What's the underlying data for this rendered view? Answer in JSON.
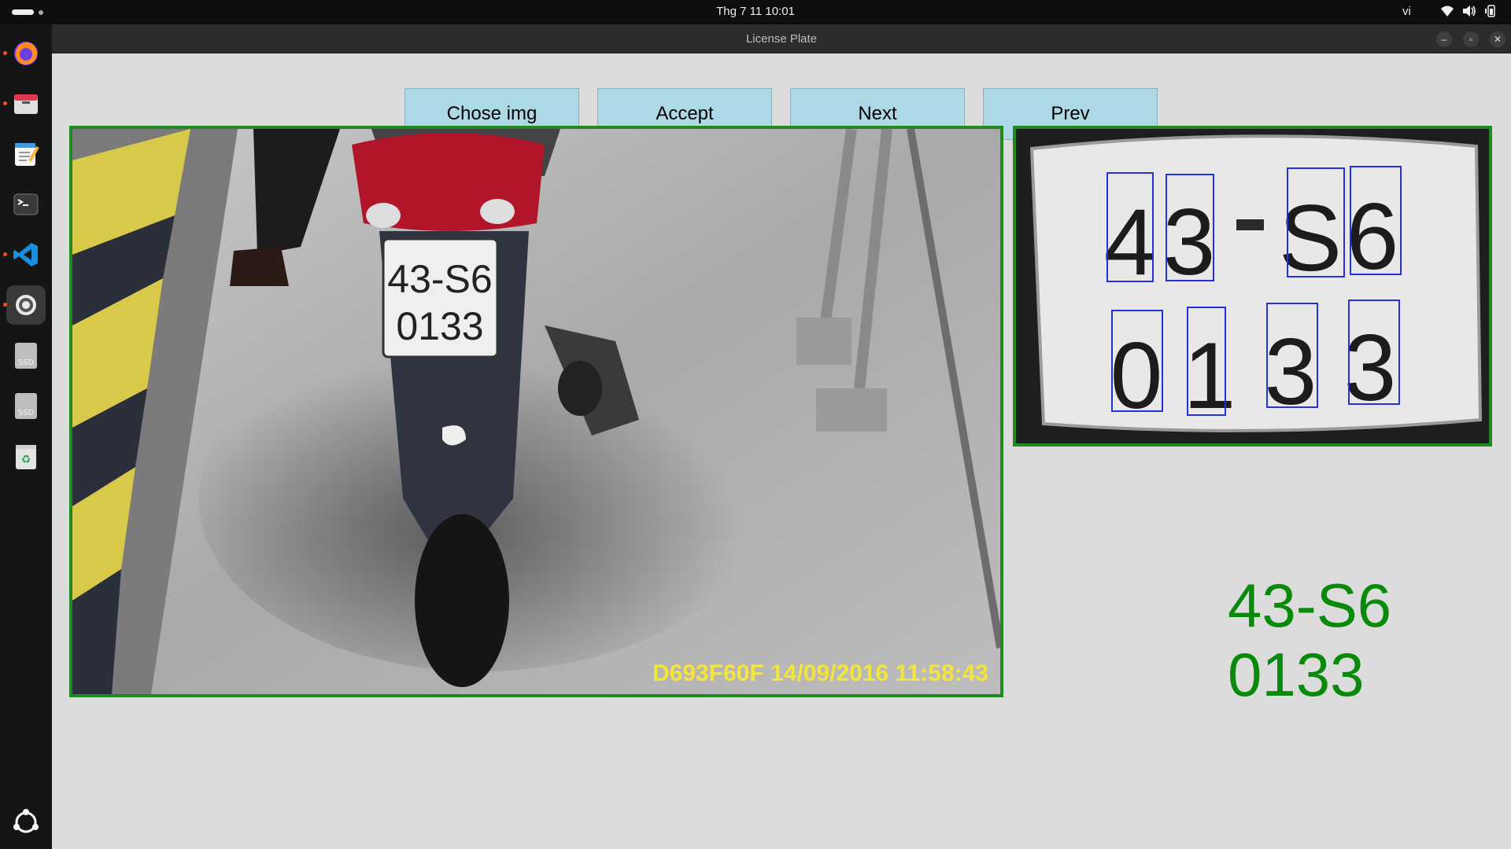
{
  "topbar": {
    "clock": "Thg 7 11  10:01",
    "lang": "vi"
  },
  "dock": {
    "items": [
      {
        "name": "firefox-icon",
        "running": true
      },
      {
        "name": "files-icon",
        "running": true
      },
      {
        "name": "text-editor-icon",
        "running": false
      },
      {
        "name": "terminal-icon",
        "running": false
      },
      {
        "name": "vscode-icon",
        "running": true
      },
      {
        "name": "settings-icon",
        "running": true,
        "active": true
      },
      {
        "name": "ssd-drive-icon",
        "label": "SSD"
      },
      {
        "name": "ssd-drive-icon",
        "label": "SSD"
      },
      {
        "name": "trash-icon"
      },
      {
        "name": "ubuntu-apps-icon"
      }
    ]
  },
  "window": {
    "title": "License Plate"
  },
  "toolbar": {
    "chose_label": "Chose img",
    "accept_label": "Accept",
    "next_label": "Next",
    "prev_label": "Prev"
  },
  "camera": {
    "overlay": "D693F60F  14/09/2016 11:58:43",
    "plate_line1": "43-S6",
    "plate_line2": "0133"
  },
  "plate_crop": {
    "chars_row1": [
      "4",
      "3",
      "S",
      "6"
    ],
    "chars_row2": [
      "0",
      "1",
      "3",
      "3"
    ]
  },
  "result": {
    "line1": "43-S6",
    "line2": "0133"
  },
  "colors": {
    "button_bg": "#add8e6",
    "frame_green": "#1f8a1f",
    "result_green": "#0a8a0a",
    "box_blue": "#2233dd"
  }
}
